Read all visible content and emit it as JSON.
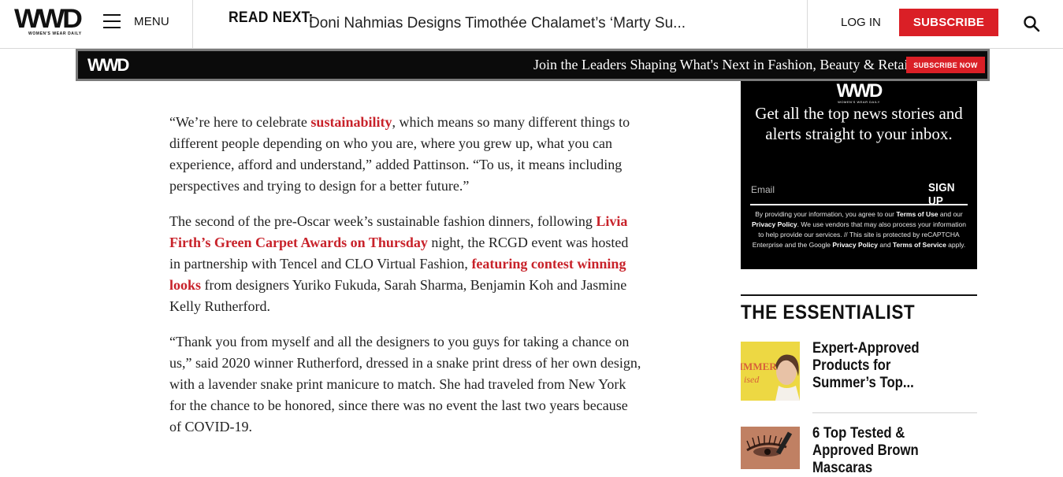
{
  "header": {
    "logo": "WWD",
    "logo_sub": "WOMEN'S WEAR DAILY",
    "menu_label": "MENU",
    "read_next_label": "READ NEXT:",
    "read_next_title": "Doni Nahmias Designs Timothée Chalamet’s ‘Marty Su...",
    "login_label": "LOG IN",
    "subscribe_label": "SUBSCRIBE",
    "search_icon": "search-icon"
  },
  "banner": {
    "logo": "WWD",
    "text": "Join the Leaders Shaping What's Next in Fashion, Beauty & Retail.",
    "button": "SUBSCRIBE NOW"
  },
  "article": {
    "p1": {
      "a": "“We’re here to celebrate ",
      "link1": "sustainability",
      "b": ", which means so many different things to different people depending on who you are, where you grew up, what you can experience, afford and understand,” added Pattinson. “To us, it means including perspectives and trying to design for a better future.”"
    },
    "p2": {
      "a": "The second of the pre-Oscar week’s sustainable fashion dinners, following ",
      "link1": "Livia Firth’s Green Carpet Awards on Thursday",
      "b": " night, the RCGD event was hosted in partnership with Tencel and CLO Virtual Fashion, ",
      "link2": "featuring contest winning looks",
      "c": " from designers Yuriko Fukuda, Sarah Sharma, Benjamin Koh and Jasmine Kelly Rutherford."
    },
    "p3": "“Thank you from myself and all the designers to you guys for taking a chance on us,” said 2020 winner Rutherford, dressed in a snake print dress of her own design, with a lavender snake print manicure to match. She had traveled from New York for the chance to be honored, since there was no event the last two years because of COVID-19."
  },
  "newsletter": {
    "logo": "WWD",
    "logo_sub": "WOMEN'S WEAR DAILY",
    "heading": "Get all the top news stories and alerts straight to your inbox.",
    "email_placeholder": "Email",
    "signup_label": "SIGN UP",
    "disclaimer": {
      "t1": "By providing your information, you agree to our ",
      "terms": "Terms of Use",
      "t2": " and our ",
      "privacy": "Privacy Policy",
      "t3": ". We use vendors that may also process your information to help provide our services. // This site is protected by reCAPTCHA Enterprise and the Google ",
      "gprivacy": "Privacy Policy",
      "t4": " and ",
      "gterms": "Terms of Service",
      "t5": " apply."
    }
  },
  "essentialist": {
    "title": "THE ESSENTIALIST",
    "items": [
      {
        "title": "Expert-Approved Products for Summer’s Top...",
        "thumb_text": "IMMER"
      },
      {
        "title": "6 Top Tested & Approved Brown Mascaras"
      }
    ]
  }
}
